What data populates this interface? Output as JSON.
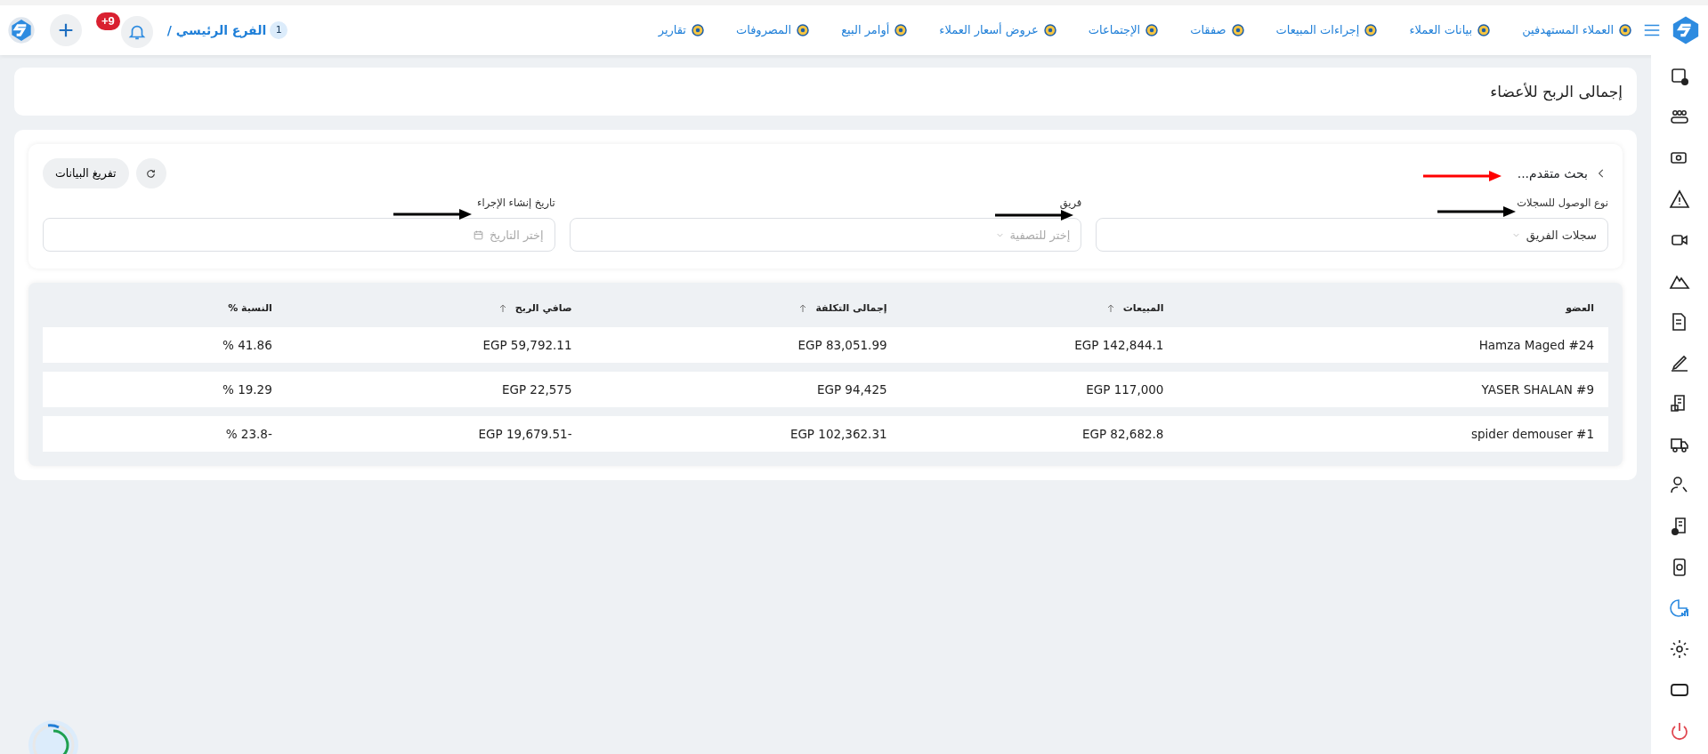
{
  "topbar": {
    "nav": [
      {
        "label": "العملاء المستهدفين"
      },
      {
        "label": "بيانات العملاء"
      },
      {
        "label": "إجراءات المبيعات"
      },
      {
        "label": "صفقات"
      },
      {
        "label": "الإجتماعات"
      },
      {
        "label": "عروض أسعار العملاء"
      },
      {
        "label": "أوامر البيع"
      },
      {
        "label": "المصروفات"
      },
      {
        "label": "تقارير"
      }
    ],
    "branch": {
      "number": "1",
      "label": "الفرع الرئيسي /"
    },
    "notifications_badge": "+9"
  },
  "sidebar": {
    "items": [
      {
        "selected": false
      },
      {
        "selected": false
      },
      {
        "selected": false
      },
      {
        "selected": false
      },
      {
        "selected": false
      },
      {
        "selected": false
      },
      {
        "selected": false
      },
      {
        "selected": false
      },
      {
        "selected": false
      },
      {
        "selected": false
      },
      {
        "selected": false
      },
      {
        "selected": false
      },
      {
        "selected": false
      },
      {
        "selected": true
      },
      {
        "selected": false
      },
      {
        "selected": false
      },
      {
        "selected": false
      }
    ]
  },
  "page_title": "إجمالى الربح للأعضاء",
  "filters": {
    "toggle": "بحث متقدم...",
    "clear_button": "تفريغ البيانات",
    "fields": [
      {
        "kind": "select",
        "label": "نوع الوصول للسجلات",
        "value": "سجلات الفريق"
      },
      {
        "kind": "select",
        "label": "فريق",
        "placeholder": "إختر للتصفية"
      },
      {
        "kind": "date",
        "label": "تاريخ إنشاء الإجراء",
        "placeholder": "إختر التاريخ"
      }
    ]
  },
  "annotations": [
    {
      "color": "#ff0000"
    },
    {
      "color": "#000000"
    },
    {
      "color": "#000000"
    },
    {
      "color": "#000000"
    }
  ],
  "table": {
    "columns": [
      {
        "label": "العضو",
        "sortable": false
      },
      {
        "label": "المبيعات",
        "sortable": true
      },
      {
        "label": "إجمالى التكلفة",
        "sortable": true
      },
      {
        "label": "صافي الربح",
        "sortable": true
      },
      {
        "label": "النسبة %",
        "sortable": false
      }
    ],
    "rows": [
      [
        "Hamza Maged #24",
        "EGP 142,844.1",
        "EGP 83,051.99",
        "EGP 59,792.11",
        "% 41.86"
      ],
      [
        "YASER SHALAN #9",
        "EGP 117,000",
        "EGP 94,425",
        "EGP 22,575",
        "% 19.29"
      ],
      [
        "spider demouser #1",
        "EGP 82,682.8",
        "EGP 102,362.31",
        "EGP 19,679.51-",
        "% 23.8-"
      ]
    ]
  }
}
